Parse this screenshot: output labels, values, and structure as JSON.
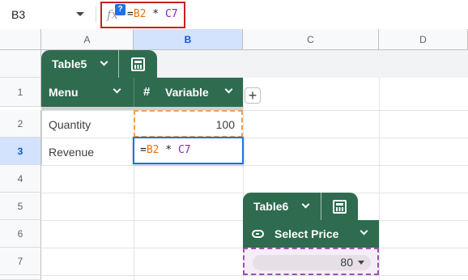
{
  "formula_bar": {
    "name_box": "B3",
    "fx": "fx",
    "help_badge": "?",
    "formula_parts": [
      "=",
      "B2",
      " * ",
      "C7"
    ]
  },
  "columns": [
    "A",
    "B",
    "C",
    "D"
  ],
  "rows": [
    "1",
    "2",
    "3",
    "4",
    "5",
    "6",
    "7"
  ],
  "table5": {
    "name": "Table5",
    "col_a_header": "Menu",
    "col_b_header": "Variable",
    "hash": "#",
    "add_column": "+",
    "cells": {
      "a2": "Quantity",
      "b2": "100",
      "a3": "Revenue"
    },
    "editing_formula": [
      "=",
      "B2",
      " * ",
      "C7"
    ]
  },
  "table6": {
    "name": "Table6",
    "header": "Select Price",
    "dropdown_value": "80"
  },
  "colors": {
    "table_green": "#2e6b4f",
    "selection_blue": "#1a73e8",
    "ref_orange": "#e8710a",
    "ref_purple": "#8e24aa"
  }
}
